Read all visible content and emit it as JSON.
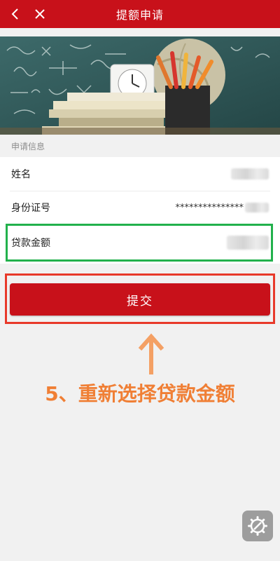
{
  "header": {
    "title": "提额申请",
    "back_icon": "chevron-left-icon",
    "close_icon": "close-icon"
  },
  "section": {
    "label": "申请信息"
  },
  "form": {
    "name_label": "姓名",
    "id_label": "身份证号",
    "id_value": "***************",
    "amount_label": "贷款金额"
  },
  "submit": {
    "label": "提交"
  },
  "instruction": {
    "text": "5、重新选择贷款金额"
  },
  "colors": {
    "brand_red": "#c8111a",
    "highlight_green": "#22b14c",
    "highlight_red": "#e8392a",
    "instruction_orange": "#f07f35"
  },
  "float_button": {
    "icon": "settings-tool-icon"
  }
}
